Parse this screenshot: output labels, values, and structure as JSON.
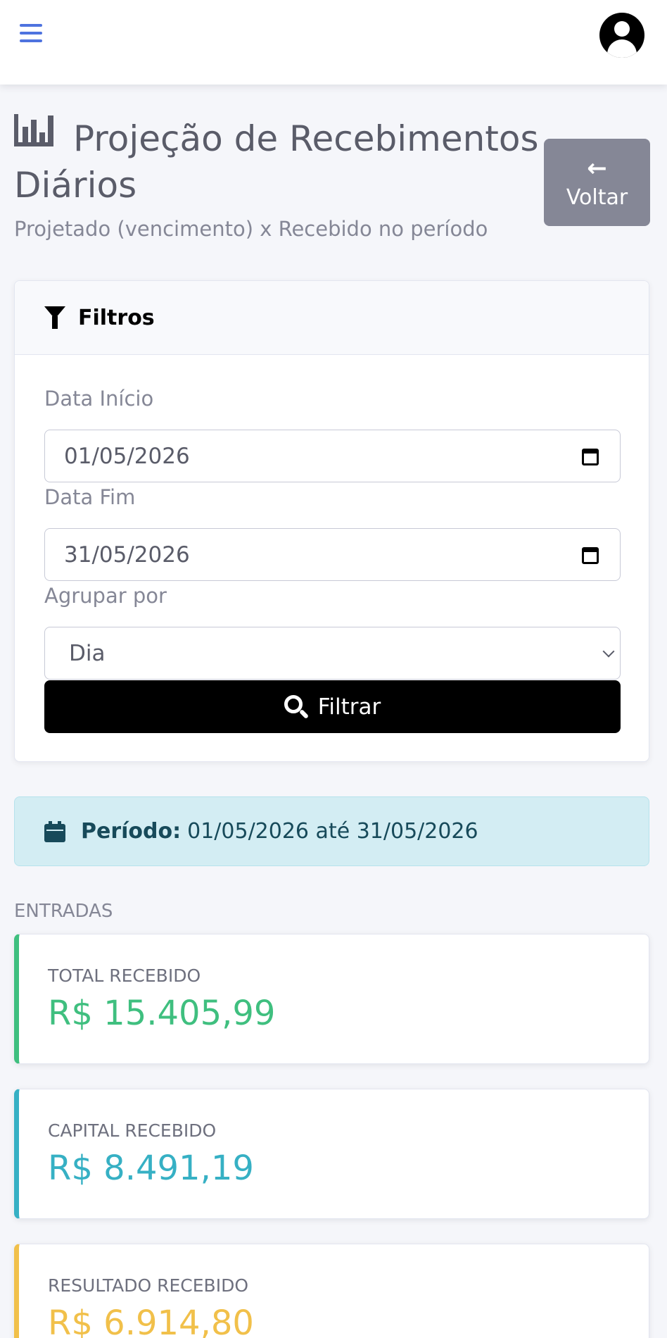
{
  "header": {
    "menu_icon": "hamburger-menu-icon",
    "avatar_icon": "user-circle-icon"
  },
  "page": {
    "title": "Projeção de Recebimentos Diários",
    "title_icon": "bar-chart-icon",
    "subtitle": "Projetado (vencimento) x Recebido no período",
    "back_label": "Voltar",
    "back_icon": "arrow-left-icon"
  },
  "filters": {
    "title": "Filtros",
    "title_icon": "filter-icon",
    "start_label": "Data Início",
    "start_value": "01/05/2026",
    "end_label": "Data Fim",
    "end_value": "31/05/2026",
    "group_label": "Agrupar por",
    "group_value": "Dia",
    "filter_label": "Filtrar",
    "filter_icon": "search-icon"
  },
  "period": {
    "icon": "calendar-icon",
    "label": "Período:",
    "value": "01/05/2026 até 31/05/2026"
  },
  "entradas": {
    "section_label": "ENTRADAS",
    "cards": [
      {
        "label": "TOTAL RECEBIDO",
        "value": "R$ 15.405,99",
        "color": "#3fbf7f"
      },
      {
        "label": "CAPITAL RECEBIDO",
        "value": "R$ 8.491,19",
        "color": "#36b0c4"
      },
      {
        "label": "RESULTADO RECEBIDO",
        "value": "R$ 6.914,80",
        "color": "#f1c04a"
      }
    ]
  }
}
